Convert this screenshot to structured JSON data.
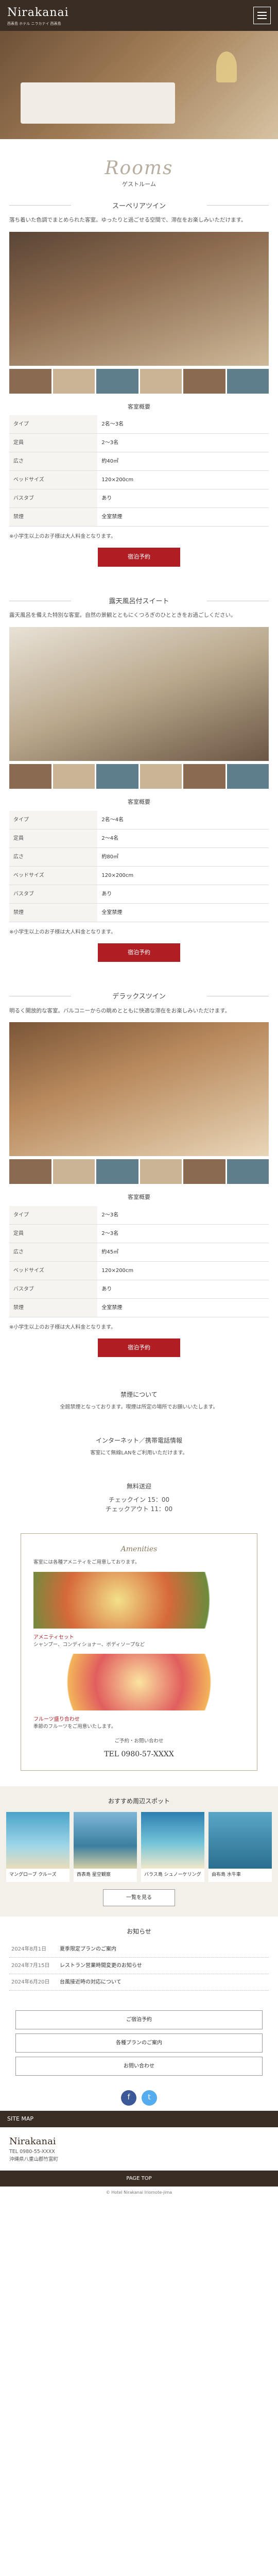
{
  "header": {
    "logo": "Nirakanai",
    "logo_sub": "西表島 ホテル ニラカナイ 西表島"
  },
  "rooms_section": {
    "title_en": "Rooms",
    "title_ja": "ゲストルーム"
  },
  "rooms": [
    {
      "name": "スーペリアツイン",
      "intro": "落ち着いた色調でまとめられた客室。ゆったりと過ごせる空間で、滞在をお楽しみいただけます。",
      "subh": "客室概要",
      "spec": [
        [
          "タイプ",
          "2名〜3名"
        ],
        [
          "定員",
          "2〜3名"
        ],
        [
          "広さ",
          "約40㎡"
        ],
        [
          "ベッドサイズ",
          "120×200cm"
        ],
        [
          "バスタブ",
          "あり"
        ],
        [
          "禁煙",
          "全室禁煙"
        ]
      ],
      "note": "※小学生以上のお子様は大人料金となります。",
      "btn": "宿泊予約"
    },
    {
      "name": "露天風呂付スイート",
      "intro": "露天風呂を備えた特別な客室。自然の景観とともにくつろぎのひとときをお過ごしください。",
      "subh": "客室概要",
      "spec": [
        [
          "タイプ",
          "2名〜4名"
        ],
        [
          "定員",
          "2〜4名"
        ],
        [
          "広さ",
          "約80㎡"
        ],
        [
          "ベッドサイズ",
          "120×200cm"
        ],
        [
          "バスタブ",
          "あり"
        ],
        [
          "禁煙",
          "全室禁煙"
        ]
      ],
      "note": "※小学生以上のお子様は大人料金となります。",
      "btn": "宿泊予約"
    },
    {
      "name": "デラックスツイン",
      "intro": "明るく開放的な客室。バルコニーからの眺めとともに快適な滞在をお楽しみいただけます。",
      "subh": "客室概要",
      "spec": [
        [
          "タイプ",
          "2〜3名"
        ],
        [
          "定員",
          "2〜3名"
        ],
        [
          "広さ",
          "約45㎡"
        ],
        [
          "ベッドサイズ",
          "120×200cm"
        ],
        [
          "バスタブ",
          "あり"
        ],
        [
          "禁煙",
          "全室禁煙"
        ]
      ],
      "note": "※小学生以上のお子様は大人料金となります。",
      "btn": "宿泊予約"
    }
  ],
  "info": [
    {
      "title": "禁煙について",
      "text": "全館禁煙となっております。喫煙は所定の場所でお願いいたします。"
    },
    {
      "title": "インターネット／携帯電話情報",
      "text": "客室にて無線LANをご利用いただけます。"
    },
    {
      "title": "無料送迎",
      "text": "チェックイン 15：00\nチェックアウト 11：00"
    }
  ],
  "amenities": {
    "title": "Amenities",
    "text": "客室には各種アメニティをご用意しております。",
    "item1_label": "アメニティセット",
    "item1_text": "シャンプー、コンディショナー、ボディソープなど",
    "item2_label": "フルーツ盛り合わせ",
    "item2_text": "季節のフルーツをご用意いたします。",
    "contact": "ご予約・お問い合わせ",
    "tel": "TEL 0980-57-XXXX"
  },
  "spots": {
    "title": "おすすめ周辺スポット",
    "cards": [
      "マングローブ クルーズ",
      "西表島 星空観察",
      "バラス島 シュノーケリング",
      "由布島 水牛車"
    ],
    "btn": "一覧を見る"
  },
  "news": {
    "title": "お知らせ",
    "rows": [
      [
        "2024年8月1日",
        "夏季限定プランのご案内"
      ],
      [
        "2024年7月15日",
        "レストラン営業時間変更のお知らせ"
      ],
      [
        "2024年6月20日",
        "台風接近時の対応について"
      ]
    ]
  },
  "links": [
    "ご宿泊予約",
    "各種プランのご案内",
    "お問い合わせ"
  ],
  "social": [
    "f",
    "t"
  ],
  "sitemap": "SITE MAP",
  "footer": {
    "name": "Nirakanai",
    "tel": "TEL 0980-55-XXXX",
    "addr": "沖縄県八重山郡竹富町"
  },
  "pagetop": "PAGE TOP",
  "copyright": "© Hotel Nirakanai Iriomote-jima"
}
